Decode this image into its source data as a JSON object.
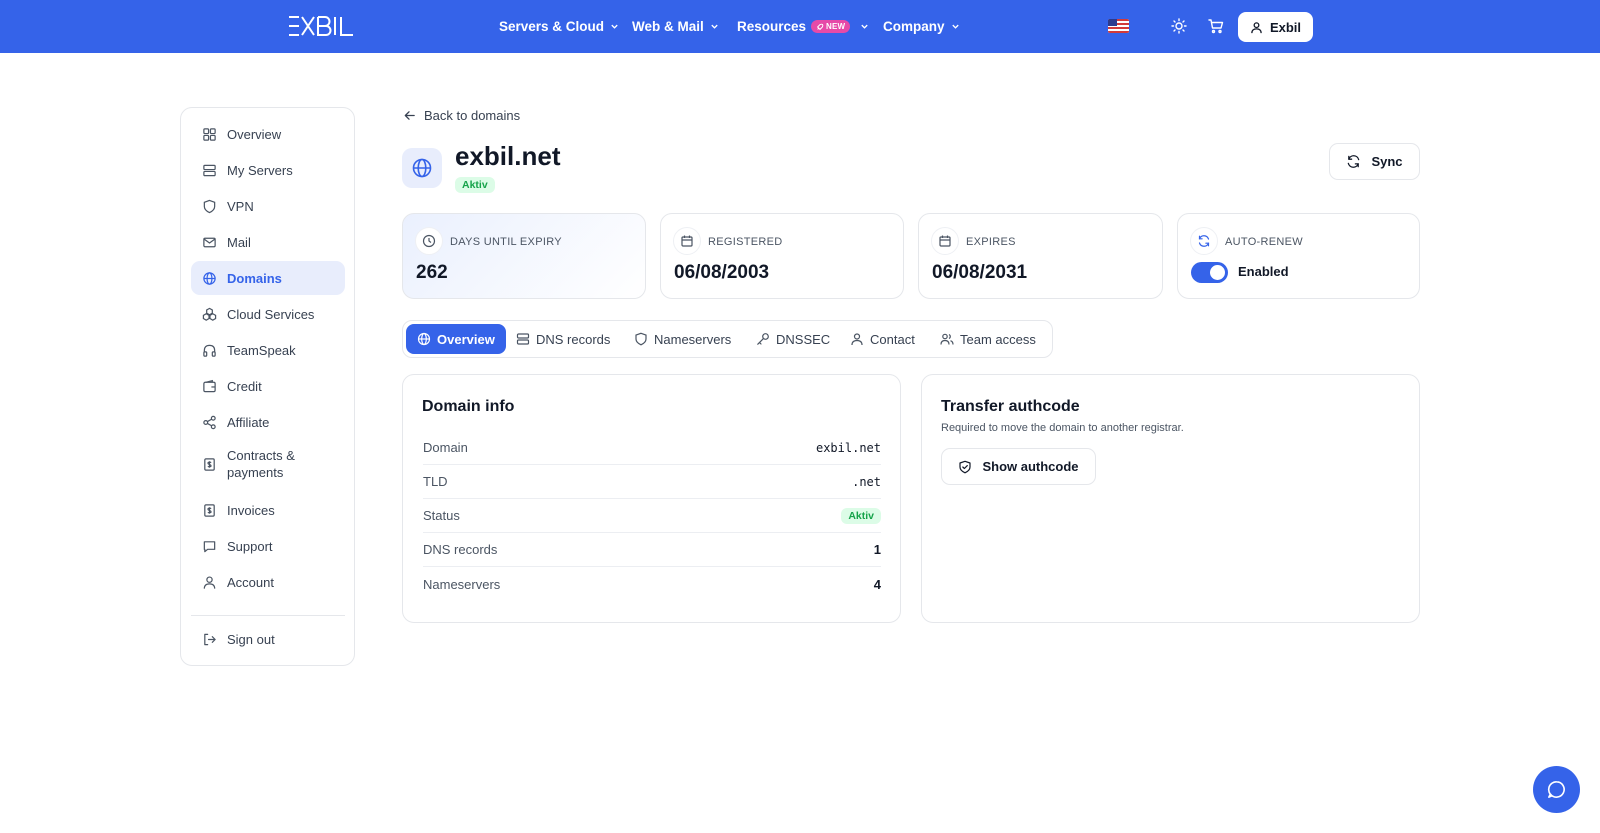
{
  "brand": {
    "logo_text": "EXBIL"
  },
  "nav": {
    "items": [
      {
        "label": "Servers & Cloud"
      },
      {
        "label": "Web & Mail"
      },
      {
        "label": "Resources",
        "badge": "NEW"
      },
      {
        "label": "Company"
      }
    ],
    "user_label": "Exbil",
    "icons": [
      "us-flag-icon",
      "sun-icon",
      "cart-icon",
      "user-icon"
    ]
  },
  "sidebar": {
    "items": [
      {
        "label": "Overview",
        "icon": "grid-icon"
      },
      {
        "label": "My Servers",
        "icon": "server-icon"
      },
      {
        "label": "VPN",
        "icon": "shield-icon"
      },
      {
        "label": "Mail",
        "icon": "mail-icon"
      },
      {
        "label": "Domains",
        "icon": "globe-icon",
        "active": true
      },
      {
        "label": "Cloud Services",
        "icon": "cloud-services-icon"
      },
      {
        "label": "TeamSpeak",
        "icon": "headphones-icon"
      },
      {
        "label": "Credit",
        "icon": "wallet-icon"
      },
      {
        "label": "Affiliate",
        "icon": "share-icon"
      },
      {
        "label": "Contracts & payments",
        "icon": "contract-icon"
      },
      {
        "label": "Invoices",
        "icon": "invoice-icon"
      },
      {
        "label": "Support",
        "icon": "chat-icon"
      },
      {
        "label": "Account",
        "icon": "user-icon"
      },
      {
        "label": "Sign out",
        "icon": "logout-icon"
      }
    ]
  },
  "header": {
    "back_label": "Back to domains",
    "domain": "exbil.net",
    "status": "Aktiv",
    "sync_label": "Sync"
  },
  "stats": [
    {
      "label": "DAYS UNTIL EXPIRY",
      "value": "262",
      "icon": "clock-icon"
    },
    {
      "label": "REGISTERED",
      "value": "06/08/2003",
      "icon": "calendar-icon"
    },
    {
      "label": "EXPIRES",
      "value": "06/08/2031",
      "icon": "calendar-icon"
    },
    {
      "label": "AUTO-RENEW",
      "value": "Enabled",
      "icon": "refresh-icon",
      "toggle_on": true
    }
  ],
  "tabs": [
    {
      "label": "Overview",
      "icon": "globe-icon",
      "active": true
    },
    {
      "label": "DNS records",
      "icon": "server-icon"
    },
    {
      "label": "Nameservers",
      "icon": "shield-icon"
    },
    {
      "label": "DNSSEC",
      "icon": "key-icon"
    },
    {
      "label": "Contact",
      "icon": "user-icon"
    },
    {
      "label": "Team access",
      "icon": "users-icon"
    }
  ],
  "domain_info": {
    "title": "Domain info",
    "rows": [
      {
        "label": "Domain",
        "value": "exbil.net"
      },
      {
        "label": "TLD",
        "value": ".net"
      },
      {
        "label": "Status",
        "value": "Aktiv"
      },
      {
        "label": "DNS records",
        "value": "1"
      },
      {
        "label": "Nameservers",
        "value": "4"
      }
    ]
  },
  "authcode": {
    "title": "Transfer authcode",
    "subtitle": "Required to move the domain to another registrar.",
    "button_label": "Show authcode"
  },
  "colors": {
    "primary": "#3563e9",
    "success": "#16a34a",
    "success_bg": "#dcfce7",
    "active_bg": "#e8edfc"
  }
}
